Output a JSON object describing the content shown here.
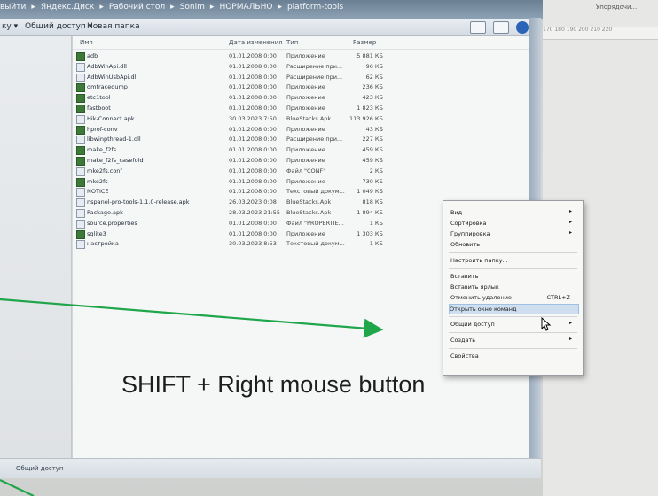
{
  "address_bar": {
    "crumbs": [
      "выйти",
      "Яндекс.Диск",
      "Рабочий стол",
      "Sonim",
      "НОРМАЛЬНО",
      "platform-tools"
    ]
  },
  "toolbar": {
    "organize_label": "ку ▾",
    "share_label": "Общий доступ ▾",
    "new_folder_label": "Новая папка"
  },
  "columns": {
    "name": "Имя",
    "date": "Дата изменения",
    "type": "Тип",
    "size": "Размер"
  },
  "files": [
    {
      "name": "adb",
      "date": "01.01.2008 0:00",
      "type": "Приложение",
      "size": "5 881 КБ",
      "icon": "app-icon"
    },
    {
      "name": "AdbWinApi.dll",
      "date": "01.01.2008 0:00",
      "type": "Расширение при...",
      "size": "96 КБ",
      "icon": "dll-icon"
    },
    {
      "name": "AdbWinUsbApi.dll",
      "date": "01.01.2008 0:00",
      "type": "Расширение при...",
      "size": "62 КБ",
      "icon": "dll-icon"
    },
    {
      "name": "dmtracedump",
      "date": "01.01.2008 0:00",
      "type": "Приложение",
      "size": "236 КБ",
      "icon": "app-icon"
    },
    {
      "name": "etc1tool",
      "date": "01.01.2008 0:00",
      "type": "Приложение",
      "size": "423 КБ",
      "icon": "app-icon"
    },
    {
      "name": "fastboot",
      "date": "01.01.2008 0:00",
      "type": "Приложение",
      "size": "1 823 КБ",
      "icon": "app-icon"
    },
    {
      "name": "Hik-Connect.apk",
      "date": "30.03.2023 7:50",
      "type": "BlueStacks.Apk",
      "size": "113 926 КБ",
      "icon": "apk-icon"
    },
    {
      "name": "hprof-conv",
      "date": "01.01.2008 0:00",
      "type": "Приложение",
      "size": "43 КБ",
      "icon": "app-icon"
    },
    {
      "name": "libwinpthread-1.dll",
      "date": "01.01.2008 0:00",
      "type": "Расширение при...",
      "size": "227 КБ",
      "icon": "dll-icon"
    },
    {
      "name": "make_f2fs",
      "date": "01.01.2008 0:00",
      "type": "Приложение",
      "size": "459 КБ",
      "icon": "app-icon"
    },
    {
      "name": "make_f2fs_casefold",
      "date": "01.01.2008 0:00",
      "type": "Приложение",
      "size": "459 КБ",
      "icon": "app-icon"
    },
    {
      "name": "mke2fs.conf",
      "date": "01.01.2008 0:00",
      "type": "Файл \"CONF\"",
      "size": "2 КБ",
      "icon": "file-icon"
    },
    {
      "name": "mke2fs",
      "date": "01.01.2008 0:00",
      "type": "Приложение",
      "size": "730 КБ",
      "icon": "app-icon"
    },
    {
      "name": "NOTICE",
      "date": "01.01.2008 0:00",
      "type": "Текстовый докум...",
      "size": "1 049 КБ",
      "icon": "file-icon"
    },
    {
      "name": "nspanel-pro-tools-1.1.0-release.apk",
      "date": "26.03.2023 0:08",
      "type": "BlueStacks.Apk",
      "size": "818 КБ",
      "icon": "apk-icon"
    },
    {
      "name": "Package.apk",
      "date": "28.03.2023 21:55",
      "type": "BlueStacks.Apk",
      "size": "1 894 КБ",
      "icon": "apk-icon"
    },
    {
      "name": "source.properties",
      "date": "01.01.2008 0:00",
      "type": "Файл \"PROPERTIE...",
      "size": "1 КБ",
      "icon": "file-icon"
    },
    {
      "name": "sqlite3",
      "date": "01.01.2008 0:00",
      "type": "Приложение",
      "size": "1 303 КБ",
      "icon": "app-icon"
    },
    {
      "name": "настройка",
      "date": "30.03.2023 8:53",
      "type": "Текстовый докум...",
      "size": "1 КБ",
      "icon": "file-icon"
    }
  ],
  "context_menu": [
    {
      "label": "Вид",
      "submenu": true
    },
    {
      "label": "Сортировка",
      "submenu": true
    },
    {
      "label": "Группировка",
      "submenu": true
    },
    {
      "label": "Обновить"
    },
    {
      "separator": true
    },
    {
      "label": "Настроить папку..."
    },
    {
      "separator": true
    },
    {
      "label": "Вставить"
    },
    {
      "label": "Вставить ярлык"
    },
    {
      "label": "Отменить удаление",
      "shortcut": "CTRL+Z"
    },
    {
      "label": "Открыть окно команд",
      "highlighted": true
    },
    {
      "separator": true
    },
    {
      "label": "Общий доступ",
      "submenu": true
    },
    {
      "separator": true
    },
    {
      "label": "Создать",
      "submenu": true
    },
    {
      "separator": true
    },
    {
      "label": "Свойства"
    }
  ],
  "statusbar": {
    "text": "Общий доступ"
  },
  "right_app": {
    "header": "Упорядочи...",
    "ruler": "170 180 190 200 210 220"
  },
  "annotation": {
    "text": "SHIFT + Right mouse button",
    "arrow_color": "#1fa64a"
  },
  "colors": {
    "window_frame": "#9aaabb",
    "menu_highlight": "#cfdff0",
    "exe_icon": "#3d7a3a"
  }
}
